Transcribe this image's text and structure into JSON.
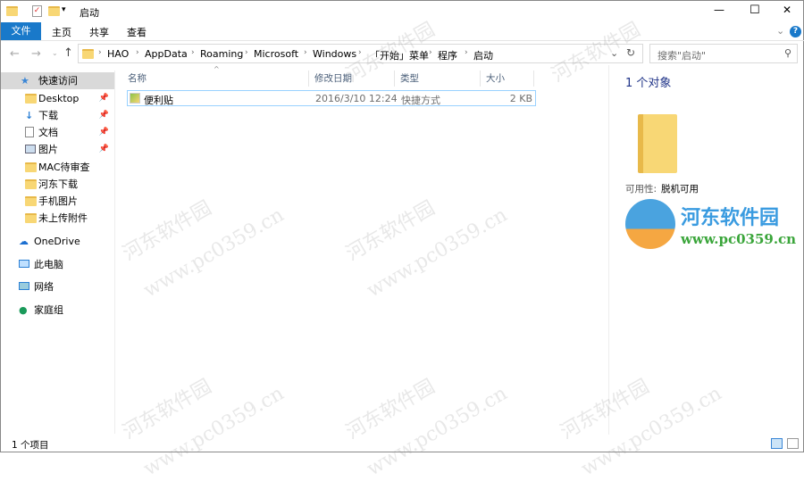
{
  "window": {
    "title": "启动",
    "min": "—",
    "max": "☐",
    "close": "✕"
  },
  "ribbon": {
    "tabs": [
      "文件",
      "主页",
      "共享",
      "查看"
    ],
    "expand": "⌄",
    "help": "?"
  },
  "address": {
    "crumbs": [
      "HAO",
      "AppData",
      "Roaming",
      "Microsoft",
      "Windows",
      "「开始」菜单",
      "程序",
      "启动"
    ]
  },
  "search": {
    "placeholder": "搜索\"启动\""
  },
  "sidebar": {
    "items": [
      {
        "label": "快速访问",
        "icon": "star-icon"
      },
      {
        "label": "Desktop",
        "icon": "folder-icon",
        "pinned": true
      },
      {
        "label": "下载",
        "icon": "download-icon",
        "pinned": true
      },
      {
        "label": "文档",
        "icon": "document-icon",
        "pinned": true
      },
      {
        "label": "图片",
        "icon": "picture-icon",
        "pinned": true
      },
      {
        "label": "MAC待审查",
        "icon": "folder-icon"
      },
      {
        "label": "河东下载",
        "icon": "folder-icon"
      },
      {
        "label": "手机图片",
        "icon": "folder-icon"
      },
      {
        "label": "未上传附件",
        "icon": "folder-icon"
      },
      {
        "label": "OneDrive",
        "icon": "cloud-icon"
      },
      {
        "label": "此电脑",
        "icon": "computer-icon"
      },
      {
        "label": "网络",
        "icon": "network-icon"
      },
      {
        "label": "家庭组",
        "icon": "homegroup-icon"
      }
    ]
  },
  "columns": [
    "名称",
    "修改日期",
    "类型",
    "大小"
  ],
  "files": [
    {
      "name": "便利贴",
      "date": "2016/3/10 12:24",
      "type": "快捷方式",
      "size": "2 KB"
    }
  ],
  "details": {
    "count": "1 个对象",
    "availability_label": "可用性:",
    "availability_value": "脱机可用"
  },
  "status": {
    "count": "1 个项目"
  },
  "logo": {
    "name": "河东软件园",
    "url": "www.pc0359.cn"
  },
  "watermark": {
    "name": "河东软件园",
    "url": "www.pc0359.cn"
  }
}
